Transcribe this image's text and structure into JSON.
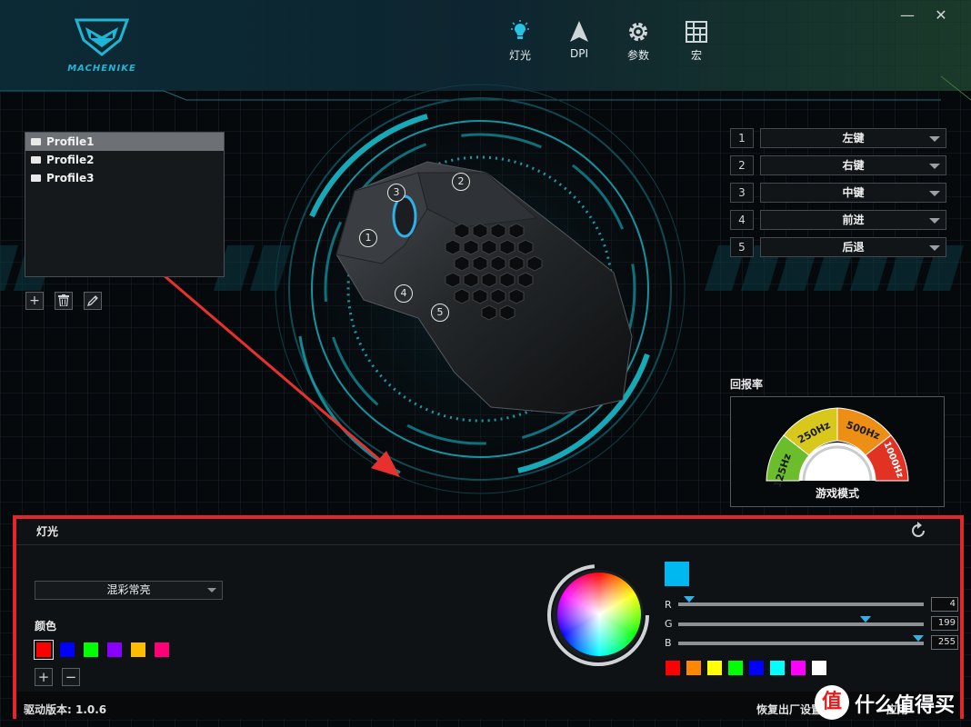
{
  "brand": {
    "logo_text": "MACHENIKE"
  },
  "nav": [
    {
      "label": "灯光",
      "icon": "light-bulb-icon"
    },
    {
      "label": "DPI",
      "icon": "arrow-cursor-icon"
    },
    {
      "label": "参数",
      "icon": "gear-icon"
    },
    {
      "label": "宏",
      "icon": "grid-icon"
    }
  ],
  "window": {
    "minimize": "—",
    "close": "✕"
  },
  "profiles": {
    "items": [
      "Profile1",
      "Profile2",
      "Profile3"
    ],
    "selected": "Profile1"
  },
  "profile_tools": {
    "add": "+",
    "delete": "trash-icon",
    "edit": "pencil-icon"
  },
  "mouse_labels": [
    "1",
    "2",
    "3",
    "4",
    "5"
  ],
  "key_map": [
    {
      "num": "1",
      "action": "左键"
    },
    {
      "num": "2",
      "action": "右键"
    },
    {
      "num": "3",
      "action": "中键"
    },
    {
      "num": "4",
      "action": "前进"
    },
    {
      "num": "5",
      "action": "后退"
    }
  ],
  "report_rate": {
    "title": "回报率",
    "segments": [
      {
        "label": "125Hz",
        "color": "#6cbd2c"
      },
      {
        "label": "250Hz",
        "color": "#d8c81c"
      },
      {
        "label": "500Hz",
        "color": "#ec8f14"
      },
      {
        "label": "1000Hz",
        "color": "#e13223"
      }
    ],
    "mode": "游戏模式"
  },
  "lighting": {
    "title": "灯光",
    "mode": "混彩常亮",
    "color_label": "颜色",
    "colors": [
      "#ff0000",
      "#0000ff",
      "#00ff00",
      "#8800ff",
      "#ffbb00",
      "#ff0077"
    ],
    "selected_color": "#ff0000",
    "add": "+",
    "remove": "−",
    "preview_color": "#00b8f0",
    "rgb": [
      {
        "label": "R",
        "value": "4"
      },
      {
        "label": "G",
        "value": "199"
      },
      {
        "label": "B",
        "value": "255"
      }
    ],
    "preset_colors": [
      "#ff0000",
      "#ff8800",
      "#ffff00",
      "#00ff00",
      "#0000ff",
      "#00ffff",
      "#ff00ff",
      "#ffffff"
    ]
  },
  "footer": {
    "version": "驱动版本: 1.0.6",
    "reset": "恢复出厂设置",
    "apply": "应用"
  },
  "watermark": {
    "glyph": "值",
    "text": "什么值得买"
  },
  "colors": {
    "accent": "#1ab3c3",
    "highlight_border": "#e2262c",
    "arrow": "#e8312f"
  }
}
